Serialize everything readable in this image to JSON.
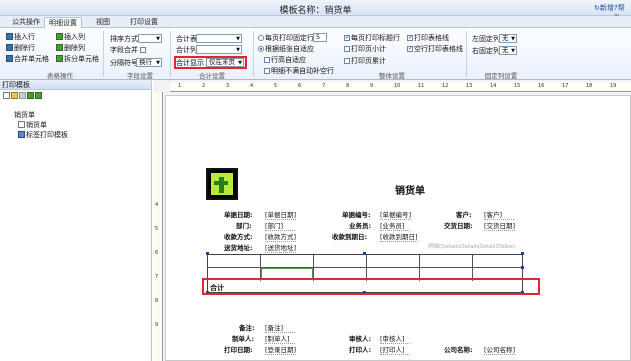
{
  "window": {
    "title": "模板名称：销货单",
    "new_label": "新增",
    "help_label": "帮助"
  },
  "tabs": [
    "公共操作",
    "明细设置",
    "视图",
    "打印设置"
  ],
  "ribbon": {
    "table_ops": {
      "insert_row": "插入行",
      "insert_col": "插入列",
      "delete_row": "删除行",
      "delete_col": "删除列",
      "merge_cells": "合并单元格",
      "split_cells": "拆分单元格",
      "group": "表格操作"
    },
    "field_settings": {
      "sort_label": "排序方式",
      "merge_field_label": "字段合并",
      "separator_label": "分隔符号",
      "separator_value": "换行",
      "group": "字段设置"
    },
    "total_settings": {
      "total_table_label": "合计表",
      "total_col_label": "合计列",
      "total_show_label": "合计显示",
      "total_show_value": "仅在末页",
      "group": "合计设置"
    },
    "overall": {
      "fixed_rows_label": "每页打印固定行",
      "fixed_rows_value": "5",
      "auto_rows_label": "根据纸张自适应",
      "row_height_label": "行高自适应",
      "detail_no_blank_label": "明细不满自动补空行",
      "print_title_label": "每页打印标题行",
      "page_subtotal_label": "打印页小计",
      "page_total_label": "打印页累计",
      "table_border_label": "打印表格线",
      "blank_border_label": "空行打印表格线",
      "group": "整体设置"
    },
    "fixed_cols": {
      "left_label": "左固定列",
      "left_value": "无",
      "right_label": "右固定列",
      "right_value": "无",
      "group": "固定列设置"
    }
  },
  "left_panel": {
    "header": "打印模板",
    "root": "销货单",
    "child1": "销货单",
    "child2": "标签打印模板"
  },
  "ruler": {
    "h": [
      "1",
      "2",
      "3",
      "4",
      "5",
      "6",
      "7",
      "8",
      "9",
      "10",
      "11",
      "12",
      "13",
      "14",
      "15",
      "16",
      "17",
      "18",
      "19"
    ],
    "v": [
      "4",
      "5",
      "6",
      "7",
      "8",
      "9"
    ]
  },
  "report": {
    "title": "销货单",
    "r1": {
      "l1": "单据日期:",
      "v1": "[单据日期]",
      "l2": "单据编号:",
      "v2": "[单据编号]",
      "l3": "客户:",
      "v3": "[客户]"
    },
    "r2": {
      "l1": "部门:",
      "v1": "[部门]",
      "l2": "业务员:",
      "v2": "[业务员]",
      "l3": "交货日期:",
      "v3": "[交货日期]"
    },
    "r3": {
      "l1": "收款方式:",
      "v1": "[收款方式]",
      "l2": "收款到期日:",
      "v2": "[收款到期日]"
    },
    "r4": {
      "l1": "送货地址:",
      "v1": "[送货地址]",
      "hint": "明细(DetailsDetailsDetail3Table)"
    },
    "total_label": "合计",
    "f1": {
      "l1": "备注:",
      "v1": "[备注]"
    },
    "f2": {
      "l1": "制单人:",
      "v1": "[制单人]",
      "l2": "审核人:",
      "v2": "[审核人]"
    },
    "f3": {
      "l1": "打印日期:",
      "v1": "[登录日期]",
      "l2": "打印人:",
      "v2": "[打印人]",
      "l3": "公司名称:",
      "v3": "[公司名称]"
    }
  }
}
